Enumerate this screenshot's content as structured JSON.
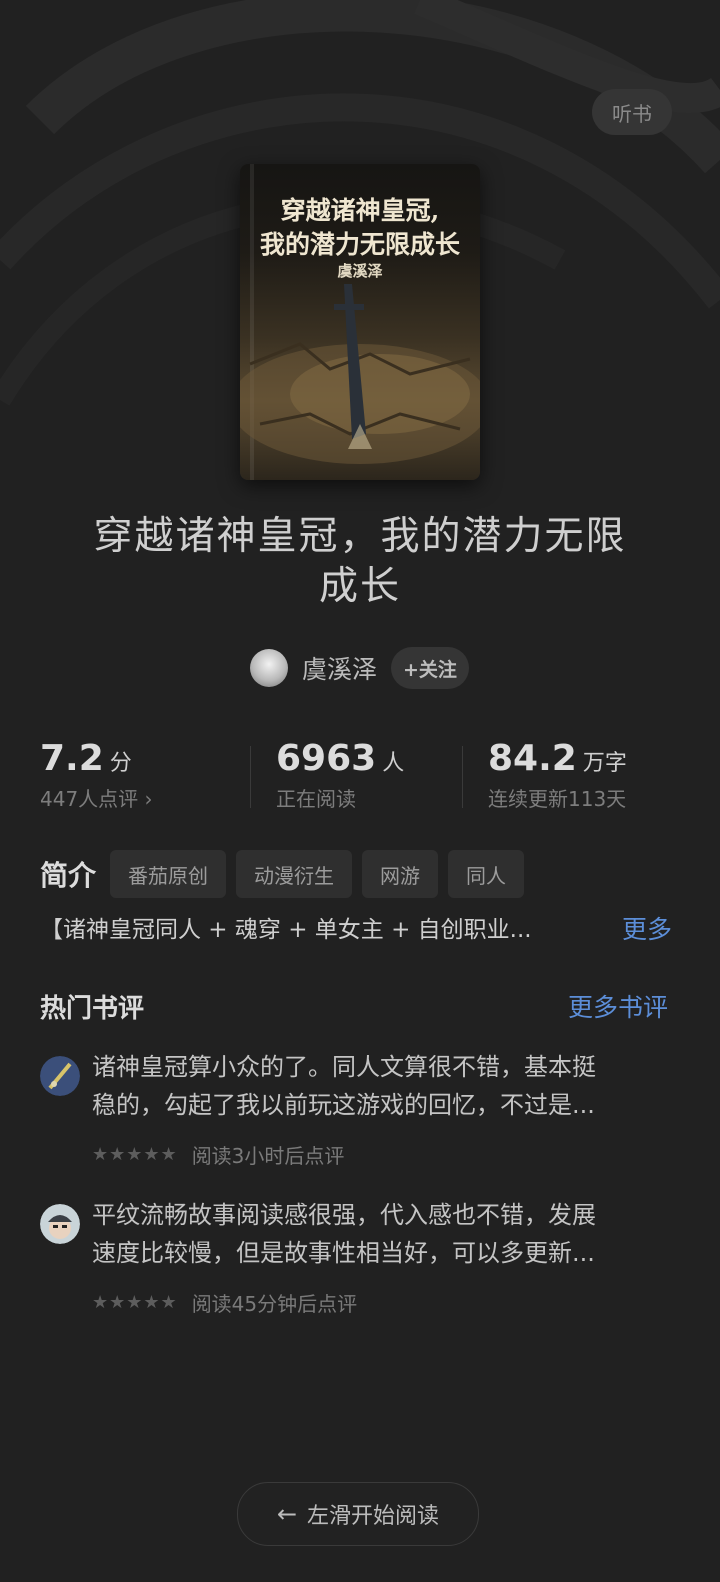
{
  "header": {
    "listen_label": "听书"
  },
  "book": {
    "cover": {
      "title_line1": "穿越诸神皇冠,",
      "title_line2": "我的潜力无限成长",
      "author": "虞溪泽"
    },
    "title_line1": "穿越诸神皇冠，我的潜力无限",
    "title_line2": "成长",
    "author": "虞溪泽",
    "follow_label": "+关注"
  },
  "stats": {
    "rating": {
      "value": "7.2",
      "unit": "分",
      "sub": "447人点评 ›"
    },
    "readers": {
      "value": "6963",
      "unit": "人",
      "sub": "正在阅读"
    },
    "words": {
      "value": "84.2",
      "unit": "万字",
      "sub": "连续更新113天"
    }
  },
  "intro": {
    "label": "简介",
    "tags": [
      "番茄原创",
      "动漫衍生",
      "网游",
      "同人"
    ],
    "description": "【诸神皇冠同人 + 魂穿 + 单女主 + 自创职业...",
    "more_label": "更多"
  },
  "reviews": {
    "title": "热门书评",
    "more_label": "更多书评",
    "items": [
      {
        "line1": "诸神皇冠算小众的了。同人文算很不错，基本挺",
        "line2": "稳的，勾起了我以前玩这游戏的回忆，不过是...",
        "stars": "★★★★★",
        "note": "阅读3小时后点评"
      },
      {
        "line1": "平纹流畅故事阅读感很强，代入感也不错，发展",
        "line2": "速度比较慢，但是故事性相当好，可以多更新...",
        "stars": "★★★★★",
        "note": "阅读45分钟后点评"
      }
    ]
  },
  "footer": {
    "arrow": "←",
    "read_label": "左滑开始阅读"
  },
  "colors": {
    "background": "#212121",
    "link": "#5c8ed8"
  }
}
